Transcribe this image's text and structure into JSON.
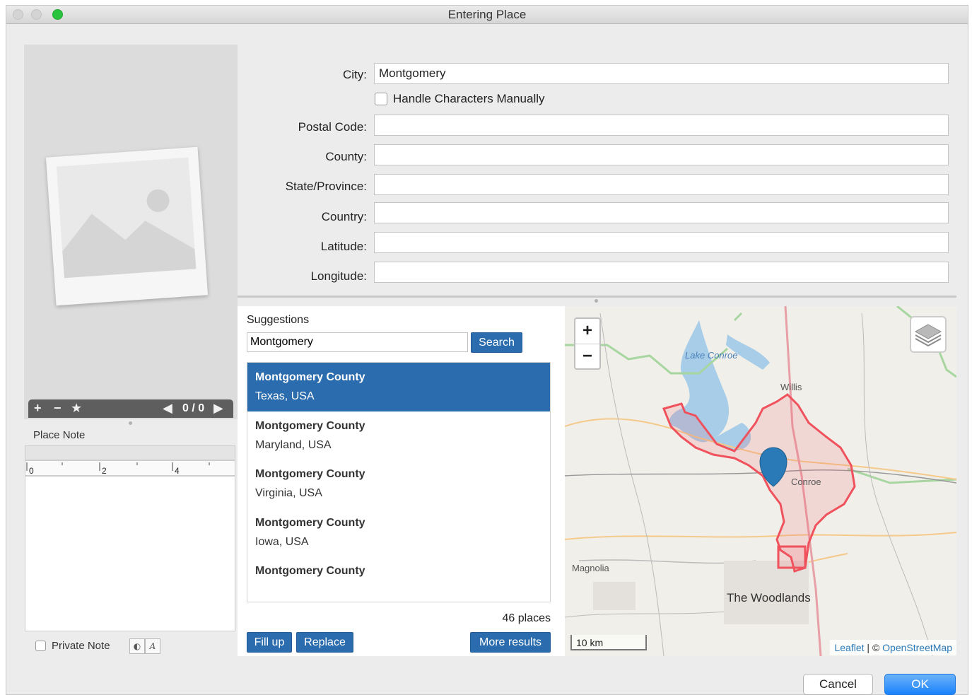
{
  "window": {
    "title": "Entering Place"
  },
  "image_panel": {
    "counter": "0 / 0",
    "add_icon": "add-icon",
    "remove_icon": "minus-icon",
    "favorite_icon": "star-icon",
    "prev_icon": "arrow-left-icon",
    "next_icon": "arrow-right-icon"
  },
  "note": {
    "title": "Place Note",
    "ruler_marks": [
      "0",
      "2",
      "4"
    ],
    "private_label": "Private Note"
  },
  "form": {
    "city_label": "City:",
    "city_value": "Montgomery",
    "handle_manually_label": "Handle Characters Manually",
    "postal_label": "Postal Code:",
    "postal_value": "",
    "county_label": "County:",
    "county_value": "",
    "state_label": "State/Province:",
    "state_value": "",
    "country_label": "Country:",
    "country_value": "",
    "latitude_label": "Latitude:",
    "latitude_value": "",
    "longitude_label": "Longitude:",
    "longitude_value": ""
  },
  "suggestions": {
    "title": "Suggestions",
    "query": "Montgomery",
    "search_label": "Search",
    "items": [
      {
        "name": "Montgomery County",
        "region": "Texas, USA",
        "selected": true
      },
      {
        "name": "Montgomery County",
        "region": "Maryland, USA",
        "selected": false
      },
      {
        "name": "Montgomery County",
        "region": "Virginia, USA",
        "selected": false
      },
      {
        "name": "Montgomery County",
        "region": "Iowa, USA",
        "selected": false
      },
      {
        "name": "Montgomery County",
        "region": "",
        "selected": false
      }
    ],
    "count": "46 places",
    "fill_up_label": "Fill up",
    "replace_label": "Replace",
    "more_results_label": "More results"
  },
  "map": {
    "zoom_in": "+",
    "zoom_out": "−",
    "scale": "10 km",
    "attribution_leaflet": "Leaflet",
    "attribution_sep": " | © ",
    "attribution_osm": "OpenStreetMap",
    "labels": {
      "lake": "Lake Conroe",
      "willis": "Willis",
      "conroe": "Conroe",
      "magnolia": "Magnolia",
      "woodlands": "The Woodlands"
    },
    "colors": {
      "boundary": "#f0525d",
      "water": "#a8cde8",
      "marker": "#2a7ab8",
      "road_major": "#e8a0a8",
      "road_minor": "#f4c98a"
    }
  },
  "footer": {
    "cancel_label": "Cancel",
    "ok_label": "OK"
  }
}
